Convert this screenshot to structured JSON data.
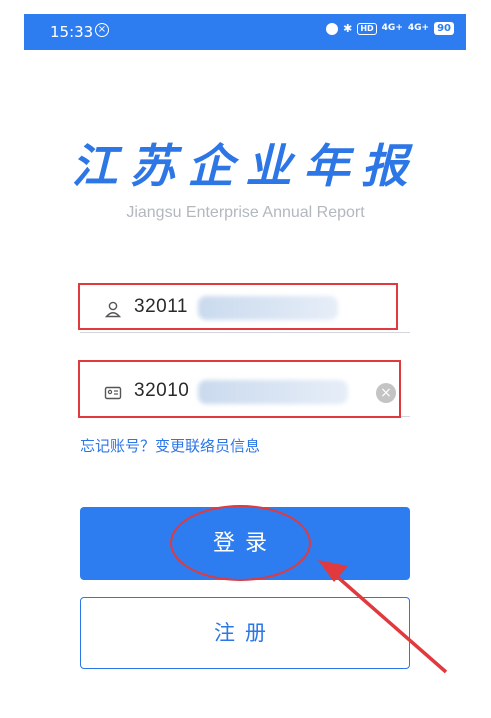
{
  "status_bar": {
    "time": "15:33",
    "alert_glyph": "×",
    "hd_label": "HD",
    "signal1": "4G+",
    "signal2": "4G+",
    "battery": "90"
  },
  "logo": {
    "title_cn": "江苏企业年报",
    "subtitle": "Jiangsu Enterprise Annual Report"
  },
  "form": {
    "username": {
      "icon": "user-icon",
      "value_visible": "32011"
    },
    "credential": {
      "icon": "id-card-icon",
      "value_visible": "32010"
    },
    "clear_glyph": "×"
  },
  "links": {
    "forgot": "忘记账号？变更联络员信息"
  },
  "buttons": {
    "login": "登录",
    "register": "注册"
  },
  "colors": {
    "primary": "#2e7df0",
    "annotation_red": "#e0393e",
    "subtitle_gray": "#b3b8bf"
  }
}
